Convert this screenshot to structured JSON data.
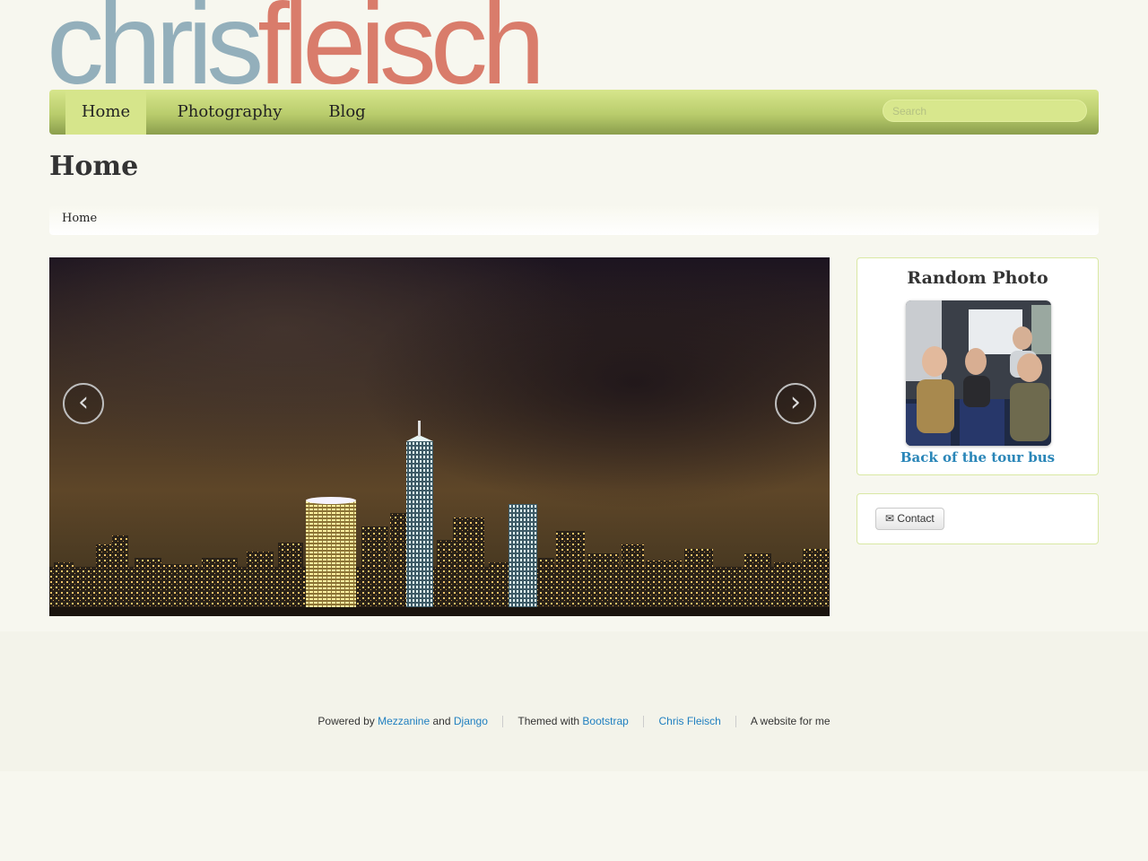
{
  "site": {
    "logo_first": "chris",
    "logo_last": "fleisch",
    "colors": {
      "logo_first": "#93afbb",
      "logo_last": "#d97c6b",
      "navbar": "#c6d77c",
      "link": "#2a86b8"
    }
  },
  "nav": {
    "items": [
      {
        "label": "Home",
        "active": true
      },
      {
        "label": "Photography",
        "active": false
      },
      {
        "label": "Blog",
        "active": false
      }
    ],
    "search_placeholder": "Search"
  },
  "page": {
    "title": "Home",
    "breadcrumb": "Home"
  },
  "slider": {
    "prev_icon": "‹",
    "next_icon": "›"
  },
  "sidebar": {
    "random_photo_title": "Random Photo",
    "random_photo_caption": "Back of the tour bus",
    "contact_icon": "✉",
    "contact_label": "Contact"
  },
  "footer": {
    "powered_by": "Powered by",
    "mezzanine": "Mezzanine",
    "and": "and",
    "django": "Django",
    "themed_with": "Themed with",
    "bootstrap": "Bootstrap",
    "author": "Chris Fleisch",
    "tagline": "A website for me"
  }
}
